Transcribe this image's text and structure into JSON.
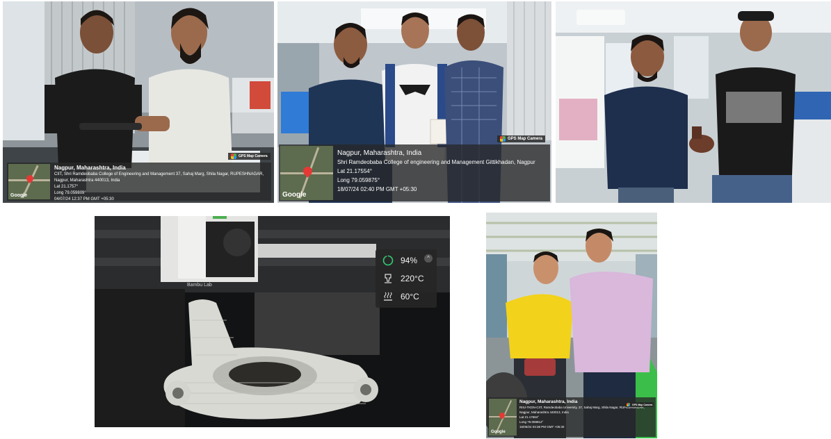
{
  "photos": [
    {
      "name": "photo-two-men-holding-part-lab",
      "gps": {
        "title": "Nagpur, Maharashtra, India",
        "address": "CIIT, Shri Ramdeobaba College of Engineering and Management 37, Sahaj Marg, Shila Nagar, RUPESHNAGAR, Nagpur, Maharashtra 440013, India",
        "lat": "Lat 21.1757°",
        "long": "Long 79.059809°",
        "datetime": "04/07/24 12:37 PM GMT +05:30",
        "badge": "GPS Map Camera",
        "google": "Google"
      }
    },
    {
      "name": "photo-three-men-holding-box",
      "gps": {
        "title": "Nagpur, Maharashtra, India",
        "address": "Shri Ramdeobaba College of engineering and Management Gittikhadan, Nagpur",
        "lat": "Lat 21.17554°",
        "long": "Long 79.059875°",
        "datetime": "18/07/24 02:40 PM GMT +05:30",
        "badge": "GPS Map Camera",
        "google": "Google"
      }
    },
    {
      "name": "photo-two-men-holding-bronze-part"
    },
    {
      "name": "photo-3d-printer-print",
      "printer": {
        "progress": "94%",
        "nozzle_temp": "220°C",
        "bed_temp": "60°C",
        "brand": "Bambu Lab",
        "progress_value": 0.94
      }
    },
    {
      "name": "photo-two-men-corridor",
      "gps": {
        "title": "Nagpur, Maharashtra, India",
        "address": "RIIU-TKDN-CIIT, Ramdeobaba University, 37, Sahaj Marg, Shila Nagar, RUPESHNAGAR, Nagpur, Maharashtra 440013, India",
        "lat": "Lat 21.17584°",
        "long": "Long 79.059812°",
        "datetime": "15/06/24 03:38 PM GMT +05:30",
        "badge": "GPS Map Camera",
        "google": "Google"
      }
    }
  ],
  "colors": {
    "overlay": "#282828",
    "map_pin": "#e53935",
    "progress_ring": "#2ecc71",
    "yellow_tshirt": "#f2d21b",
    "pink_tshirt": "#d9b8dc",
    "print_material": "#d9d9d4"
  },
  "icons": {
    "location": "map-pin-icon",
    "gps_badge": "gps-map-camera-icon",
    "progress": "progress-ring-icon",
    "nozzle": "nozzle-icon",
    "bed": "heated-bed-icon",
    "collapse": "chevron-up-icon"
  }
}
